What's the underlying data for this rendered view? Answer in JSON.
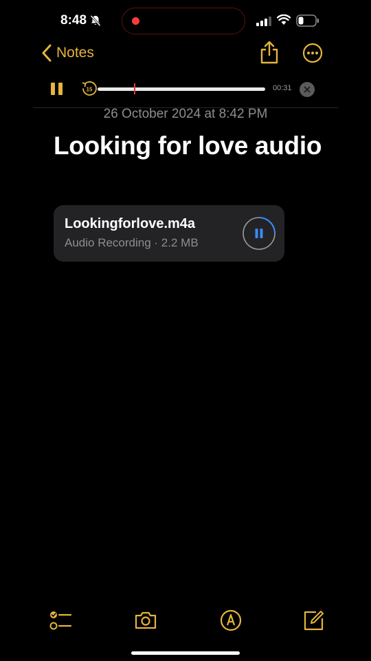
{
  "status_bar": {
    "time": "8:48",
    "icons": [
      "bell-slash-icon",
      "signal-icon",
      "wifi-icon",
      "battery-icon"
    ],
    "recording_indicator_color": "#ff3b3b"
  },
  "nav": {
    "back_label": "Notes",
    "icons": [
      "chevron-left-icon",
      "share-icon",
      "more-icon"
    ],
    "accent_color": "#e6b53c"
  },
  "player": {
    "elapsed": "00:31",
    "skip_label": "15",
    "icons": [
      "pause-icon",
      "skip-back-15-icon",
      "close-icon"
    ]
  },
  "note": {
    "date": "26 October 2024 at 8:42 PM",
    "title": "Looking for love audio"
  },
  "attachment": {
    "filename": "Lookingforlove.m4a",
    "meta": "Audio Recording · 2.2 MB",
    "icon": "pause-icon"
  },
  "toolbar": {
    "icons": [
      "checklist-icon",
      "camera-icon",
      "markup-icon",
      "compose-icon"
    ]
  }
}
